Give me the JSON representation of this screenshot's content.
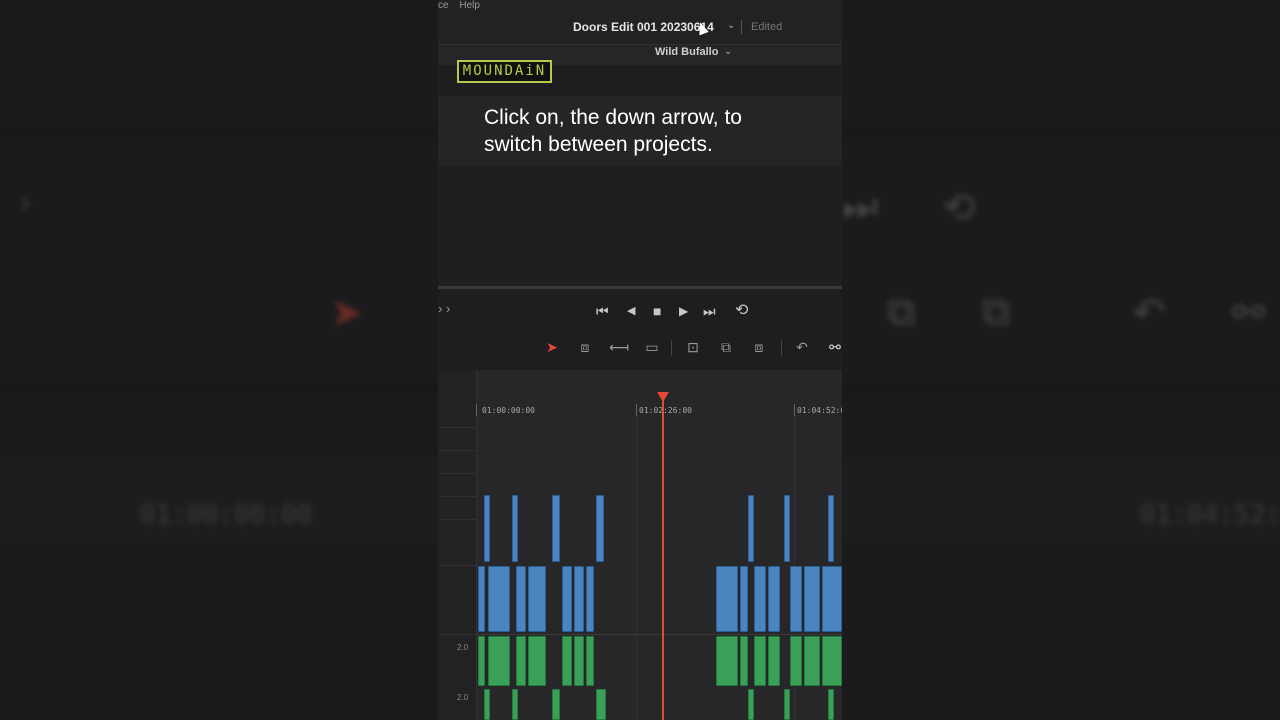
{
  "menu": {
    "items": [
      "ce",
      "Help"
    ]
  },
  "project": {
    "title": "Doors Edit 001 20230614",
    "status": "Edited",
    "workspace": "Wild Bufallo"
  },
  "logo": {
    "text": "MOUNDAiN"
  },
  "caption": {
    "text": "Click on, the down arrow, to switch between projects."
  },
  "transport": {
    "buttons": [
      "skip-to-start",
      "reverse",
      "stop",
      "play",
      "skip-to-end",
      "loop"
    ],
    "glyphs": [
      "⏮",
      "◀",
      "■",
      "▶",
      "⏭",
      "⟲"
    ]
  },
  "toolbar": {
    "tools": [
      "selection-mode",
      "trim-edit-mode",
      "dynamic-trim-mode",
      "blade-edit-mode",
      "insert-clip",
      "overwrite-clip",
      "replace-clip",
      "snapping",
      "linked-selection"
    ]
  },
  "timeline": {
    "timecodes": [
      "01:00:00:00",
      "01:02:26:00",
      "01:04:52:0"
    ],
    "track_labels": [
      "2.0",
      "2.0"
    ]
  },
  "background": {
    "timecodes": [
      "01:00:00:00",
      "01:04:52:00"
    ]
  },
  "colors": {
    "accent_playhead": "#e5493a",
    "video_clip": "#4a85bf",
    "audio_clip": "#3aa058",
    "logo": "#b6c94a"
  }
}
